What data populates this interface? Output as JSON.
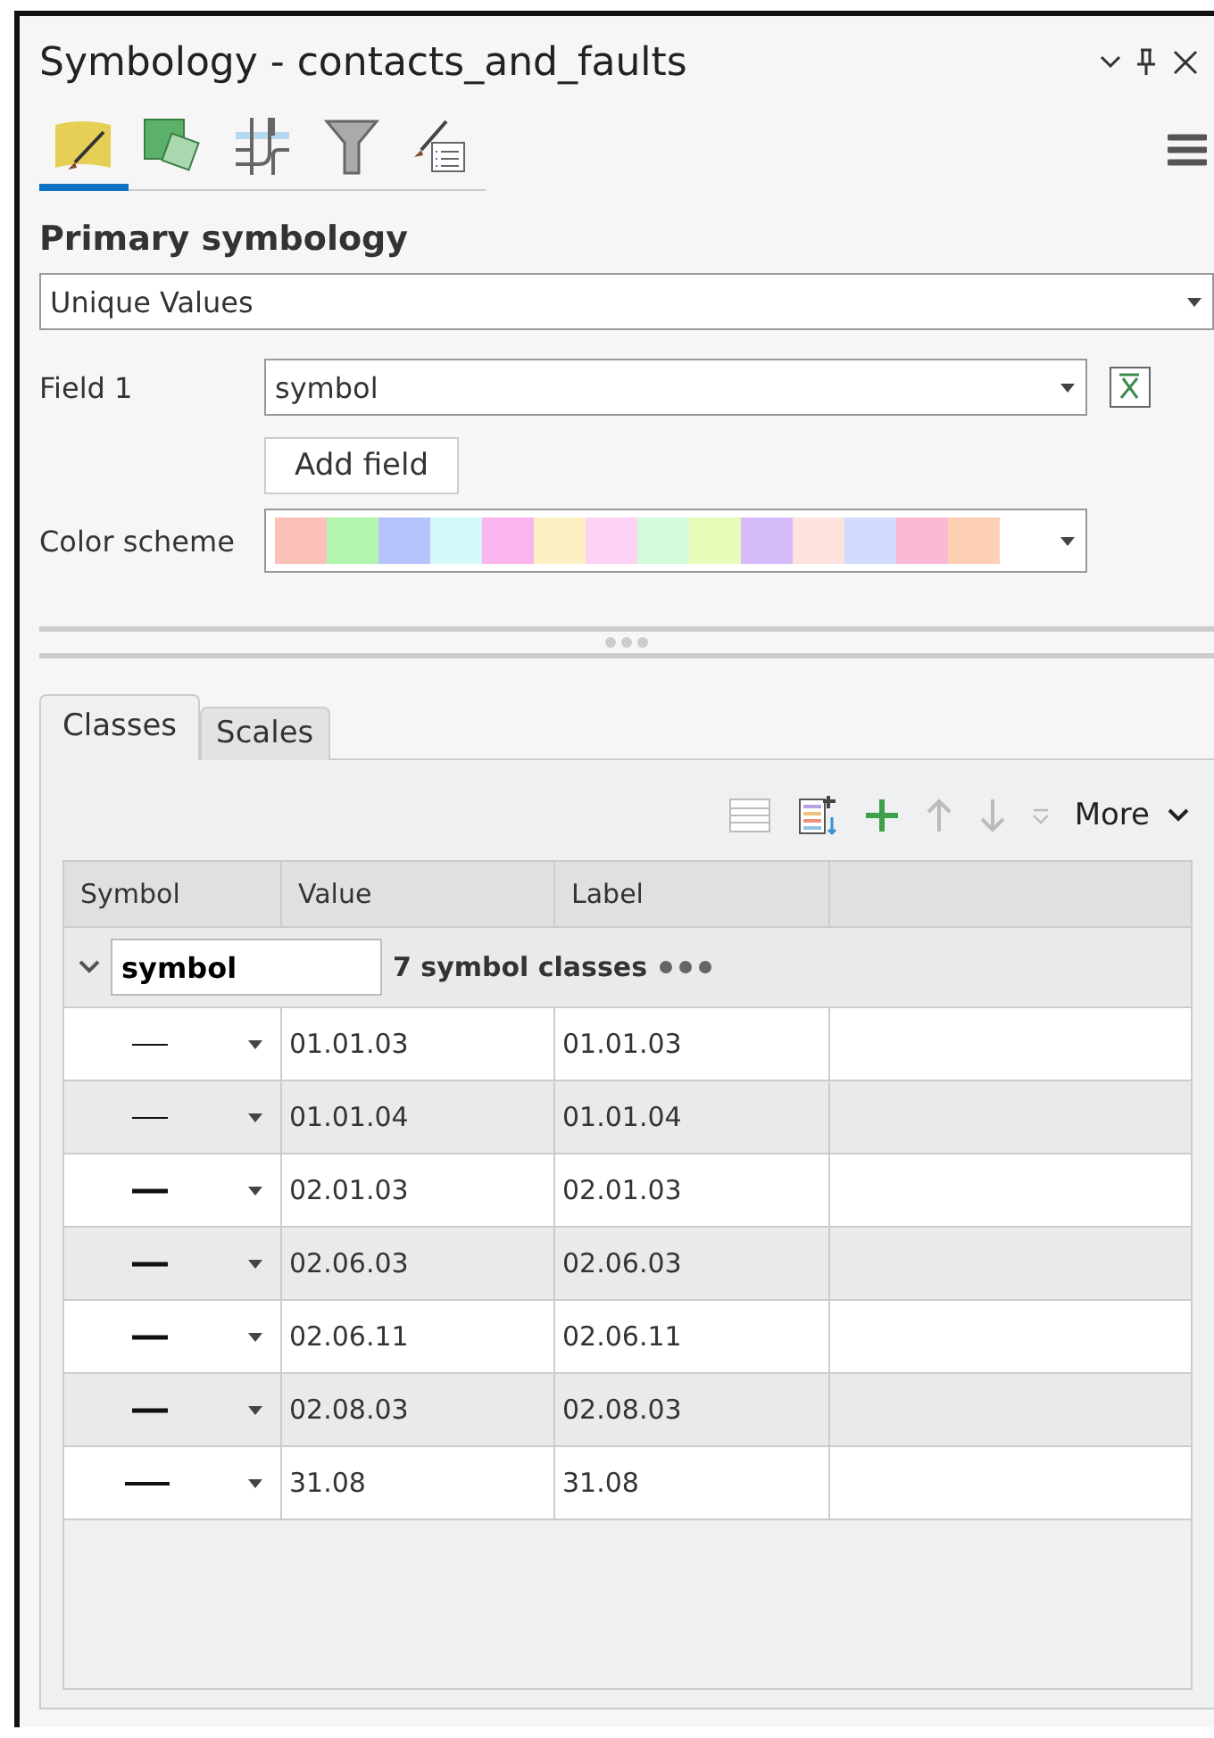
{
  "window": {
    "title": "Symbology - contacts_and_faults"
  },
  "tools": [
    {
      "kind": "brush",
      "selected": true
    },
    {
      "kind": "squares",
      "selected": false
    },
    {
      "kind": "grid",
      "selected": false
    },
    {
      "kind": "funnel",
      "selected": false
    },
    {
      "kind": "list",
      "selected": false
    }
  ],
  "section_title": "Primary symbology",
  "method": {
    "value": "Unique Values"
  },
  "field_1": {
    "label": "Field 1",
    "value": "symbol"
  },
  "add_field": "Add field",
  "color_scheme": {
    "label": "Color scheme",
    "swatches": [
      {
        "color": "#fbc0b8"
      },
      {
        "color": "#b3f6b0"
      },
      {
        "color": "#b6c3fc"
      },
      {
        "color": "#d4f9fb"
      },
      {
        "color": "#fbb4ee"
      },
      {
        "color": "#fcf0c4"
      },
      {
        "color": "#fdd3f3"
      },
      {
        "color": "#d3fbdc"
      },
      {
        "color": "#e8fcba"
      },
      {
        "color": "#d6bbfb"
      },
      {
        "color": "#fde3db"
      },
      {
        "color": "#d1dcfc"
      },
      {
        "color": "#fbb8d4"
      },
      {
        "color": "#fdd0b4"
      }
    ]
  },
  "tabs": [
    {
      "label": "Classes",
      "selected": true
    },
    {
      "label": "Scales",
      "selected": false
    }
  ],
  "toolbar": {
    "more": "More"
  },
  "table": {
    "columns": [
      "Symbol",
      "Value",
      "Label"
    ],
    "group": {
      "field": "symbol",
      "count": "7 symbol classes",
      "expanded": true
    },
    "rows": [
      {
        "kind": "thin",
        "value": "01.01.03",
        "label": "01.01.03"
      },
      {
        "kind": "thin",
        "value": "01.01.04",
        "label": "01.01.04"
      },
      {
        "kind": "thick",
        "value": "02.01.03",
        "label": "02.01.03"
      },
      {
        "kind": "thick",
        "value": "02.06.03",
        "label": "02.06.03"
      },
      {
        "kind": "thick",
        "value": "02.06.11",
        "label": "02.06.11"
      },
      {
        "kind": "thick",
        "value": "02.08.03",
        "label": "02.08.03"
      },
      {
        "kind": "long",
        "value": "31.08",
        "label": "31.08"
      }
    ]
  }
}
